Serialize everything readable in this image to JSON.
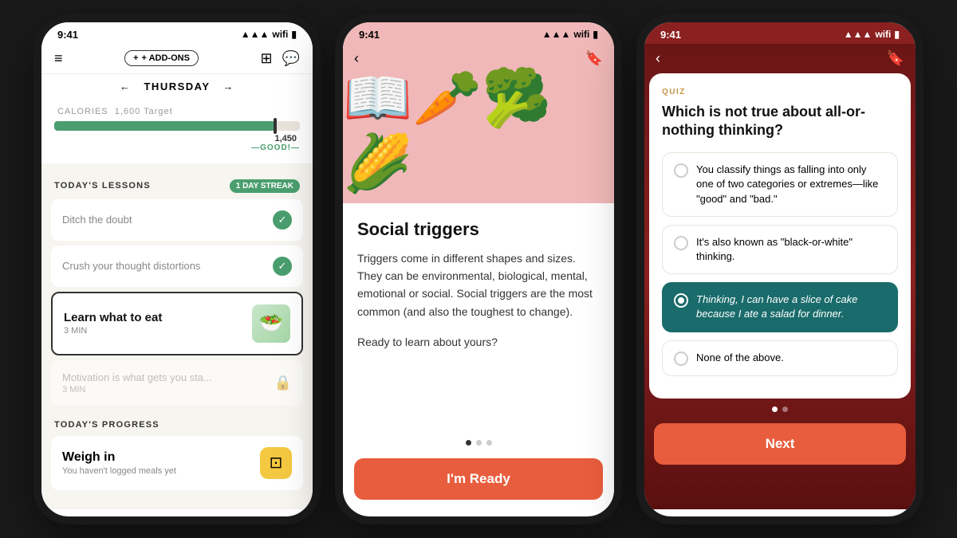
{
  "phone1": {
    "status_time": "9:41",
    "header": {
      "add_ons": "+ ADD-ONS"
    },
    "day_nav": {
      "prev": "←",
      "day": "THURSDAY",
      "next": "→"
    },
    "calories": {
      "label": "CALORIES",
      "target": "1,600 Target",
      "value": "1,450",
      "status": "—GOOD!—",
      "fill_percent": "91"
    },
    "lessons_section": {
      "title": "TODAY'S LESSONS",
      "streak": "1 DAY STREAK"
    },
    "lessons": [
      {
        "title": "Ditch the doubt",
        "completed": true,
        "locked": false
      },
      {
        "title": "Crush your thought distortions",
        "completed": true,
        "locked": false
      },
      {
        "title": "Learn what to eat",
        "subtitle": "3 MIN",
        "active": true,
        "completed": false,
        "locked": false
      },
      {
        "title": "Motivation is what gets you sta...",
        "subtitle": "3 MIN",
        "completed": false,
        "locked": true
      }
    ],
    "progress_section": {
      "title": "TODAY'S PROGRESS"
    },
    "progress_card": {
      "title": "Weigh in",
      "subtitle": "You haven't logged meals yet"
    }
  },
  "phone2": {
    "status_time": "9:41",
    "article": {
      "title": "Social triggers",
      "body_1": "Triggers come in different shapes and sizes. They can be environmental, biological, mental, emotional or social. Social triggers are the most common (and also the toughest to change).",
      "body_2": "Ready to learn about yours?",
      "button": "I'm Ready"
    },
    "dots": [
      true,
      false,
      false
    ]
  },
  "phone3": {
    "status_time": "9:41",
    "quiz": {
      "label": "QUIZ",
      "question": "Which is not true about all-or-nothing thinking?",
      "options": [
        {
          "text": "You classify things as falling into only one of two categories or extremes—like \"good\" and \"bad.\"",
          "selected": false
        },
        {
          "text": "It's also known as \"black-or-white\" thinking.",
          "selected": false
        },
        {
          "text": "Thinking, I can have a slice of cake because I ate a salad for dinner.",
          "selected": true
        },
        {
          "text": "None of the above.",
          "selected": false
        }
      ],
      "next_button": "Next"
    },
    "dots": [
      true,
      false
    ]
  }
}
